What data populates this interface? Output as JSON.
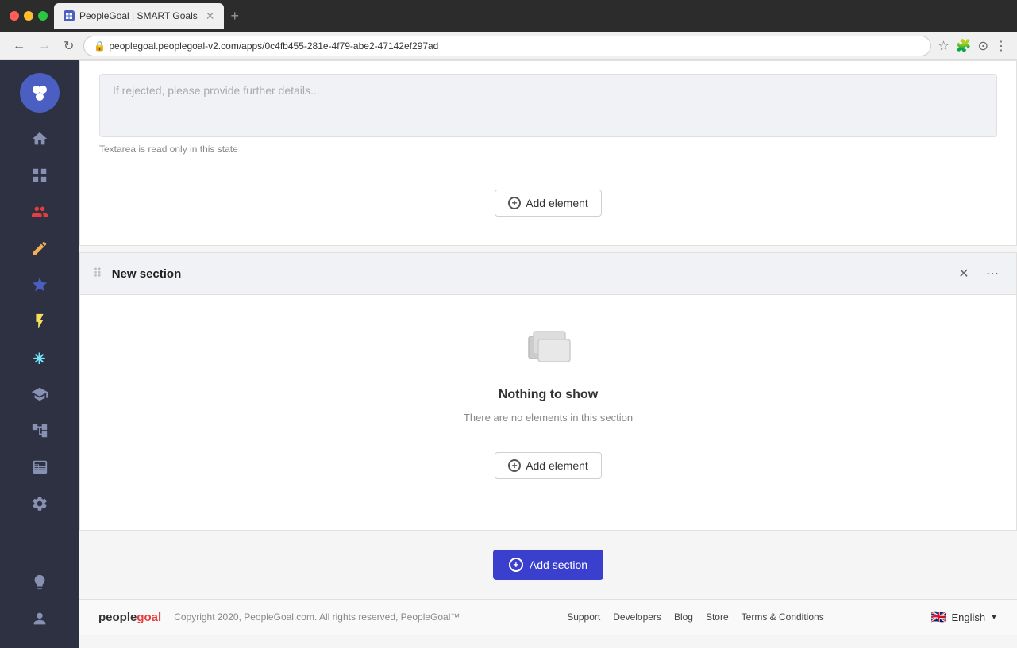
{
  "browser": {
    "tab_title": "PeopleGoal | SMART Goals",
    "url": "peoplegoal.peoplegoal-v2.com/apps/0c4fb455-281e-4f79-abe2-47142ef297ad",
    "new_tab_label": "+"
  },
  "sidebar": {
    "items": [
      {
        "id": "home",
        "label": "Home",
        "icon": "home"
      },
      {
        "id": "dashboard",
        "label": "Dashboard",
        "icon": "grid"
      },
      {
        "id": "people",
        "label": "People",
        "icon": "people"
      },
      {
        "id": "edit",
        "label": "Edit",
        "icon": "edit"
      },
      {
        "id": "goals",
        "label": "Goals",
        "icon": "star",
        "active": true
      },
      {
        "id": "pulse",
        "label": "Pulse",
        "icon": "bolt"
      },
      {
        "id": "integrations",
        "label": "Integrations",
        "icon": "asterisk"
      },
      {
        "id": "learning",
        "label": "Learning",
        "icon": "graduation"
      },
      {
        "id": "org",
        "label": "Org Chart",
        "icon": "org"
      },
      {
        "id": "table",
        "label": "Table",
        "icon": "table"
      },
      {
        "id": "settings",
        "label": "Settings",
        "icon": "gear"
      }
    ],
    "bottom_items": [
      {
        "id": "lightbulb",
        "label": "Ideas",
        "icon": "lightbulb"
      },
      {
        "id": "user",
        "label": "Profile",
        "icon": "user"
      }
    ]
  },
  "top_section": {
    "textarea_placeholder": "If rejected, please provide further details...",
    "textarea_note": "Textarea is read only in this state",
    "add_element_label": "Add element"
  },
  "new_section": {
    "title": "New section",
    "empty_title": "Nothing to show",
    "empty_desc": "There are no elements in this section",
    "add_element_label": "Add element"
  },
  "add_section": {
    "label": "Add section"
  },
  "footer": {
    "logo_text": "peoplegoal",
    "copyright": "Copyright 2020, PeopleGoal.com. All rights reserved, PeopleGoal™",
    "links": [
      "Support",
      "Developers",
      "Blog",
      "Store",
      "Terms & Conditions"
    ],
    "language": "English"
  }
}
